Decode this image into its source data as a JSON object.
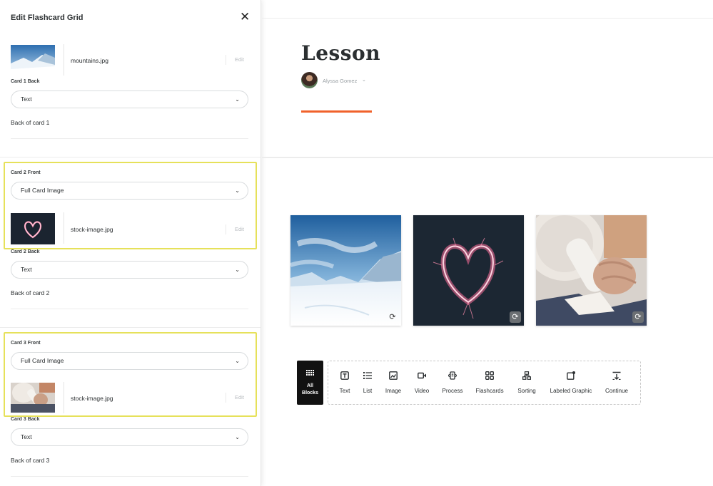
{
  "panel": {
    "title": "Edit Flashcard Grid",
    "close_glyph": "✕",
    "card1": {
      "front_file": "mountains.jpg",
      "edit_label": "Edit",
      "back_label": "Card 1 Back",
      "back_type": "Text",
      "back_text": "Back of card 1"
    },
    "card2": {
      "front_label": "Card 2 Front",
      "front_type": "Full Card Image",
      "front_file": "stock-image.jpg",
      "edit_label": "Edit",
      "back_label": "Card 2 Back",
      "back_type": "Text",
      "back_text": "Back of card 2"
    },
    "card3": {
      "front_label": "Card 3 Front",
      "front_type": "Full Card Image",
      "front_file": "stock-image.jpg",
      "edit_label": "Edit",
      "back_label": "Card 3 Back",
      "back_type": "Text",
      "back_text": "Back of card 3"
    }
  },
  "lesson": {
    "title": "Lesson",
    "author": "Alyssa Gomez",
    "accent_color": "#f0622b"
  },
  "flashcards": [
    {
      "name": "mountains",
      "icon": "refresh-icon"
    },
    {
      "name": "sparkler-heart",
      "icon": "refresh-icon"
    },
    {
      "name": "elderly-woman-phone",
      "icon": "refresh-icon"
    }
  ],
  "block_menu": {
    "all_blocks_line1": "All",
    "all_blocks_line2": "Blocks",
    "items": [
      {
        "label": "Text",
        "icon": "text-block-icon"
      },
      {
        "label": "List",
        "icon": "list-icon"
      },
      {
        "label": "Image",
        "icon": "image-icon"
      },
      {
        "label": "Video",
        "icon": "video-icon"
      },
      {
        "label": "Process",
        "icon": "process-icon"
      },
      {
        "label": "Flashcards",
        "icon": "flashcards-icon"
      },
      {
        "label": "Sorting",
        "icon": "sorting-icon"
      },
      {
        "label": "Labeled Graphic",
        "icon": "labeled-graphic-icon"
      },
      {
        "label": "Continue",
        "icon": "continue-icon"
      }
    ]
  },
  "highlight_color": "#e6e15a"
}
